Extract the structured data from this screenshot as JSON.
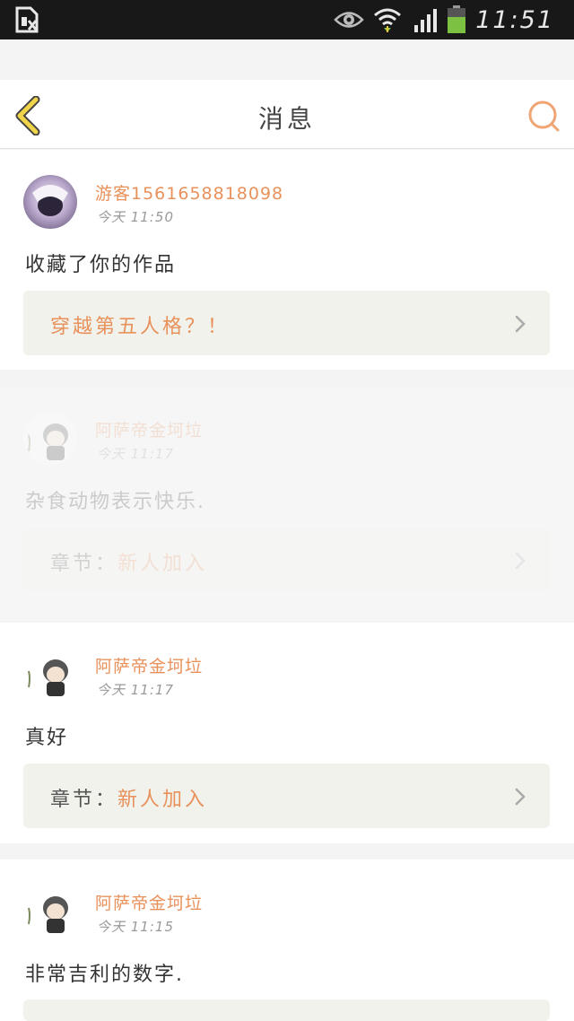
{
  "status_bar": {
    "time": "11:51"
  },
  "header": {
    "title": "消息"
  },
  "messages": [
    {
      "username": "游客1561658818098",
      "time": "今天 11:50",
      "text": "收藏了你的作品",
      "ref_prefix": "",
      "ref_title": "穿越第五人格？！"
    },
    {
      "username": "阿萨帝金坷垃",
      "time": "今天 11:17",
      "text": "杂食动物表示快乐.",
      "ref_prefix": "章节：",
      "ref_title": "新人加入"
    },
    {
      "username": "阿萨帝金坷垃",
      "time": "今天 11:17",
      "text": "真好",
      "ref_prefix": "章节：",
      "ref_title": "新人加入"
    },
    {
      "username": "阿萨帝金坷垃",
      "time": "今天 11:15",
      "text": "非常吉利的数字.",
      "ref_prefix": "",
      "ref_title": ""
    }
  ],
  "colors": {
    "accent": "#e8915b",
    "back_arrow": "#e6c43a",
    "card_ref_bg": "#f2f2ec",
    "battery": "#7cc142"
  },
  "icons": {
    "back": "back-chevron-icon",
    "search": "search-icon",
    "chevron": "chevron-right-icon"
  }
}
